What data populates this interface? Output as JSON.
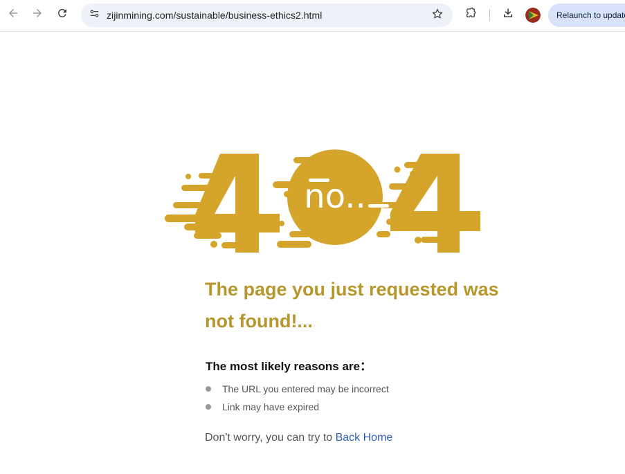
{
  "browser": {
    "url": "zijinmining.com/sustainable/business-ethics2.html",
    "relaunch_label": "Relaunch to update",
    "icons": [
      "back-icon",
      "forward-icon",
      "reload-icon",
      "site-info-icon",
      "bookmark-star-icon",
      "extensions-icon",
      "download-icon",
      "profile-avatar"
    ]
  },
  "error_page": {
    "graphic_text": "no..",
    "graphic_code": "404",
    "accent_color": "#d4a52a",
    "headline": "The page you just requested was not found!...",
    "reasons_title": "The most likely reasons are：",
    "reasons": [
      "The URL you entered may be incorrect",
      "Link may have expired"
    ],
    "footer_text": "Don't worry, you can try to ",
    "back_home_label": "Back Home"
  }
}
